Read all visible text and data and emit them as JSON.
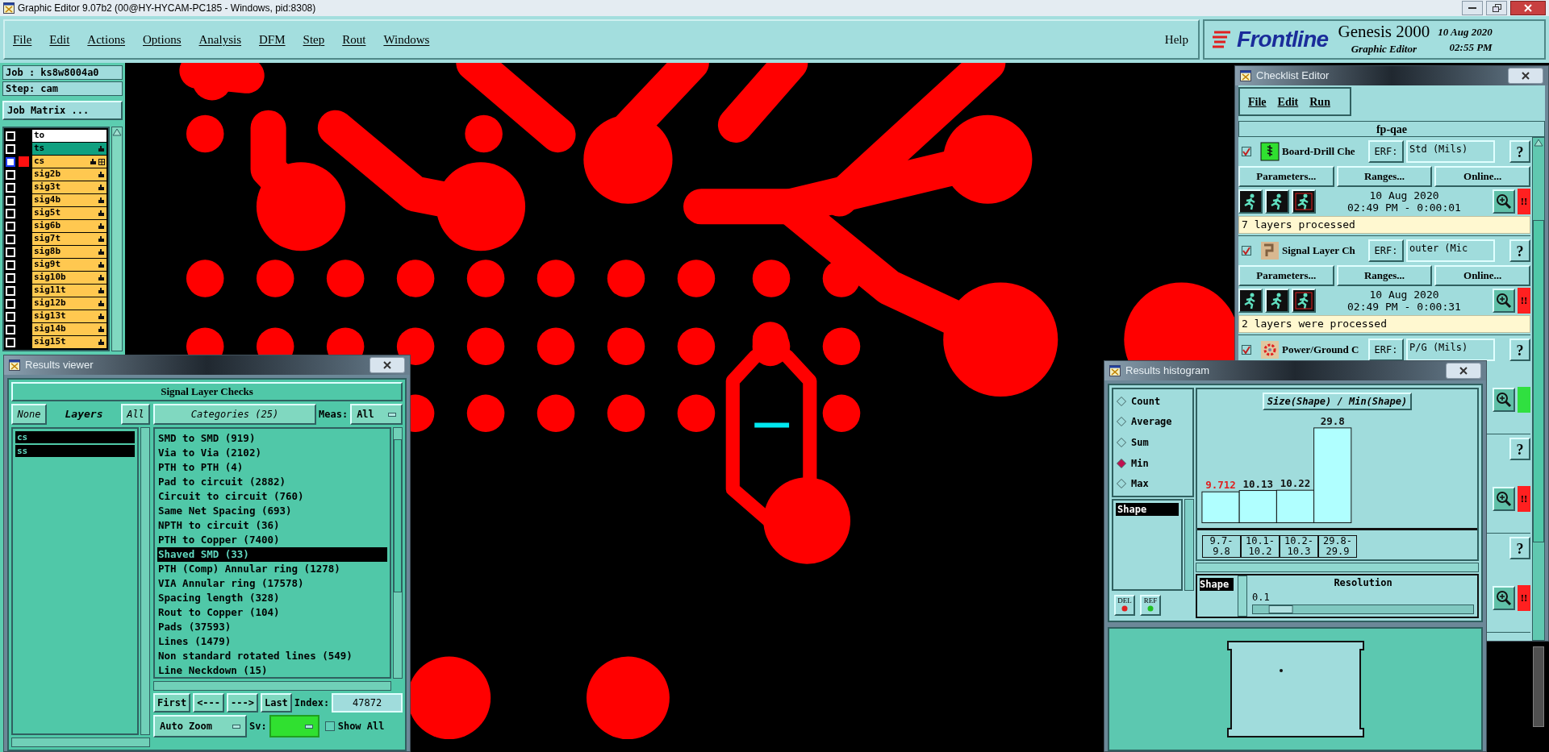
{
  "window": {
    "title": "Graphic Editor 9.07b2 (00@HY-HYCAM-PC185 - Windows, pid:8308)"
  },
  "menu": [
    "File",
    "Edit",
    "Actions",
    "Options",
    "Analysis",
    "DFM",
    "Step",
    "Rout",
    "Windows"
  ],
  "help": "Help",
  "brand": {
    "logo": "Frontline",
    "product": "Genesis 2000",
    "subtitle": "Graphic Editor",
    "date": "10 Aug 2020",
    "time": "02:55 PM"
  },
  "job": {
    "job": "Job : ks8w8004a0",
    "step": "Step: cam",
    "matrix_button": "Job Matrix ..."
  },
  "layers": [
    {
      "name": "to",
      "color": "#ffffff",
      "checked": false,
      "affected": false,
      "active": false
    },
    {
      "name": "ts",
      "color": "#10a080",
      "checked": false,
      "affected": true,
      "active": false
    },
    {
      "name": "cs",
      "color": "#ffc850",
      "checked": false,
      "affected": true,
      "active": true
    },
    {
      "name": "sig2b",
      "color": "#ffc850",
      "checked": false,
      "affected": true,
      "active": false
    },
    {
      "name": "sig3t",
      "color": "#ffc850",
      "checked": false,
      "affected": true,
      "active": false
    },
    {
      "name": "sig4b",
      "color": "#ffc850",
      "checked": false,
      "affected": true,
      "active": false
    },
    {
      "name": "sig5t",
      "color": "#ffc850",
      "checked": false,
      "affected": true,
      "active": false
    },
    {
      "name": "sig6b",
      "color": "#ffc850",
      "checked": false,
      "affected": true,
      "active": false
    },
    {
      "name": "sig7t",
      "color": "#ffc850",
      "checked": false,
      "affected": true,
      "active": false
    },
    {
      "name": "sig8b",
      "color": "#ffc850",
      "checked": false,
      "affected": true,
      "active": false
    },
    {
      "name": "sig9t",
      "color": "#ffc850",
      "checked": false,
      "affected": true,
      "active": false
    },
    {
      "name": "sig10b",
      "color": "#ffc850",
      "checked": false,
      "affected": true,
      "active": false
    },
    {
      "name": "sig11t",
      "color": "#ffc850",
      "checked": false,
      "affected": true,
      "active": false
    },
    {
      "name": "sig12b",
      "color": "#ffc850",
      "checked": false,
      "affected": true,
      "active": false
    },
    {
      "name": "sig13t",
      "color": "#ffc850",
      "checked": false,
      "affected": true,
      "active": false
    },
    {
      "name": "sig14b",
      "color": "#ffc850",
      "checked": false,
      "affected": true,
      "active": false
    },
    {
      "name": "sig15t",
      "color": "#ffc850",
      "checked": false,
      "affected": true,
      "active": false
    }
  ],
  "results_viewer": {
    "title": "Results viewer",
    "header": "Signal Layer Checks",
    "none_button": "None",
    "layers_button": "Layers",
    "all_button": "All",
    "layers": [
      {
        "name": "cs",
        "selected": true
      },
      {
        "name": "ss",
        "selected": true
      }
    ],
    "categories_button": "Categories (25)",
    "meas_label": "Meas:",
    "meas_value": "All",
    "categories": [
      {
        "label": "SMD to SMD (919)",
        "selected": false
      },
      {
        "label": "Via to Via (2102)",
        "selected": false
      },
      {
        "label": "PTH to PTH (4)",
        "selected": false
      },
      {
        "label": "Pad to circuit (2882)",
        "selected": false
      },
      {
        "label": "Circuit to circuit (760)",
        "selected": false
      },
      {
        "label": "Same Net Spacing (693)",
        "selected": false
      },
      {
        "label": "NPTH to circuit (36)",
        "selected": false
      },
      {
        "label": "PTH to Copper (7400)",
        "selected": false
      },
      {
        "label": "Shaved SMD (33)",
        "selected": true
      },
      {
        "label": "PTH (Comp) Annular ring (1278)",
        "selected": false
      },
      {
        "label": "VIA Annular ring (17578)",
        "selected": false
      },
      {
        "label": "Spacing length (328)",
        "selected": false
      },
      {
        "label": "Rout to Copper (104)",
        "selected": false
      },
      {
        "label": "Pads (37593)",
        "selected": false
      },
      {
        "label": "Lines (1479)",
        "selected": false
      },
      {
        "label": "Non standard rotated lines (549)",
        "selected": false
      },
      {
        "label": "Line Neckdown (15)",
        "selected": false
      }
    ],
    "nav": [
      "First",
      "<---",
      "--->",
      "Last"
    ],
    "index_label": "Index:",
    "index_value": "47872",
    "zoom_mode": "Auto Zoom",
    "sv_label": "Sv:",
    "show_all": {
      "label": "Show All",
      "checked": false
    }
  },
  "checklist": {
    "title": "Checklist Editor",
    "menu": [
      "File",
      "Edit",
      "Run"
    ],
    "name": "fp-qae",
    "checks": [
      {
        "kind": "drill",
        "checked": true,
        "name": "Board-Drill Che",
        "erf_label": "ERF:",
        "erf": "Std (Mils)",
        "help": "?",
        "buttons": [
          "Parameters...",
          "Ranges...",
          "Online..."
        ],
        "date": "10 Aug 2020",
        "time": "02:49 PM - 0:00:01",
        "color": "#ff2020",
        "status_text": "!!",
        "message": "7 layers processed"
      },
      {
        "kind": "signal",
        "checked": true,
        "name": "Signal Layer Ch",
        "erf_label": "ERF:",
        "erf": "outer (Mic",
        "help": "?",
        "buttons": [
          "Parameters...",
          "Ranges...",
          "Online..."
        ],
        "date": "10 Aug 2020",
        "time": "02:49 PM - 0:00:31",
        "color": "#ff2020",
        "status_text": "!!",
        "message": "2 layers were processed"
      },
      {
        "kind": "power",
        "checked": true,
        "name": "Power/Ground C",
        "erf_label": "ERF:",
        "erf": "P/G (Mils)",
        "help": "?",
        "color": "#30e040"
      },
      {
        "kind": "hidden",
        "help": "?",
        "color": "#ff2020",
        "status_text": "!!"
      },
      {
        "kind": "hidden",
        "help": "?",
        "color": "#ff2020",
        "status_text": "!!"
      }
    ]
  },
  "histogram": {
    "title": "Results histogram",
    "modes": [
      {
        "label": "Count",
        "selected": false
      },
      {
        "label": "Average",
        "selected": false
      },
      {
        "label": "Sum",
        "selected": false
      },
      {
        "label": "Min",
        "selected": true
      },
      {
        "label": "Max",
        "selected": false
      }
    ],
    "fields": [
      {
        "name": "Shape",
        "selected": true
      }
    ],
    "del_button": "DEL",
    "ref_button": "REF",
    "chart_data": {
      "type": "bar",
      "title": "Size(Shape) / Min(Shape)",
      "categories": [
        "9.7-9.8",
        "10.1-10.2",
        "10.2-10.3",
        "29.8-29.9"
      ],
      "values": [
        9.712,
        10.13,
        10.22,
        29.8
      ],
      "value_labels": [
        "9.712",
        "10.13",
        "10.22",
        "29.8"
      ]
    },
    "resolution_fields": [
      {
        "name": "Shape",
        "selected": true
      }
    ],
    "resolution_label": "Resolution",
    "resolution_value": "0.1",
    "resolution": {
      "level": 0.08
    }
  }
}
